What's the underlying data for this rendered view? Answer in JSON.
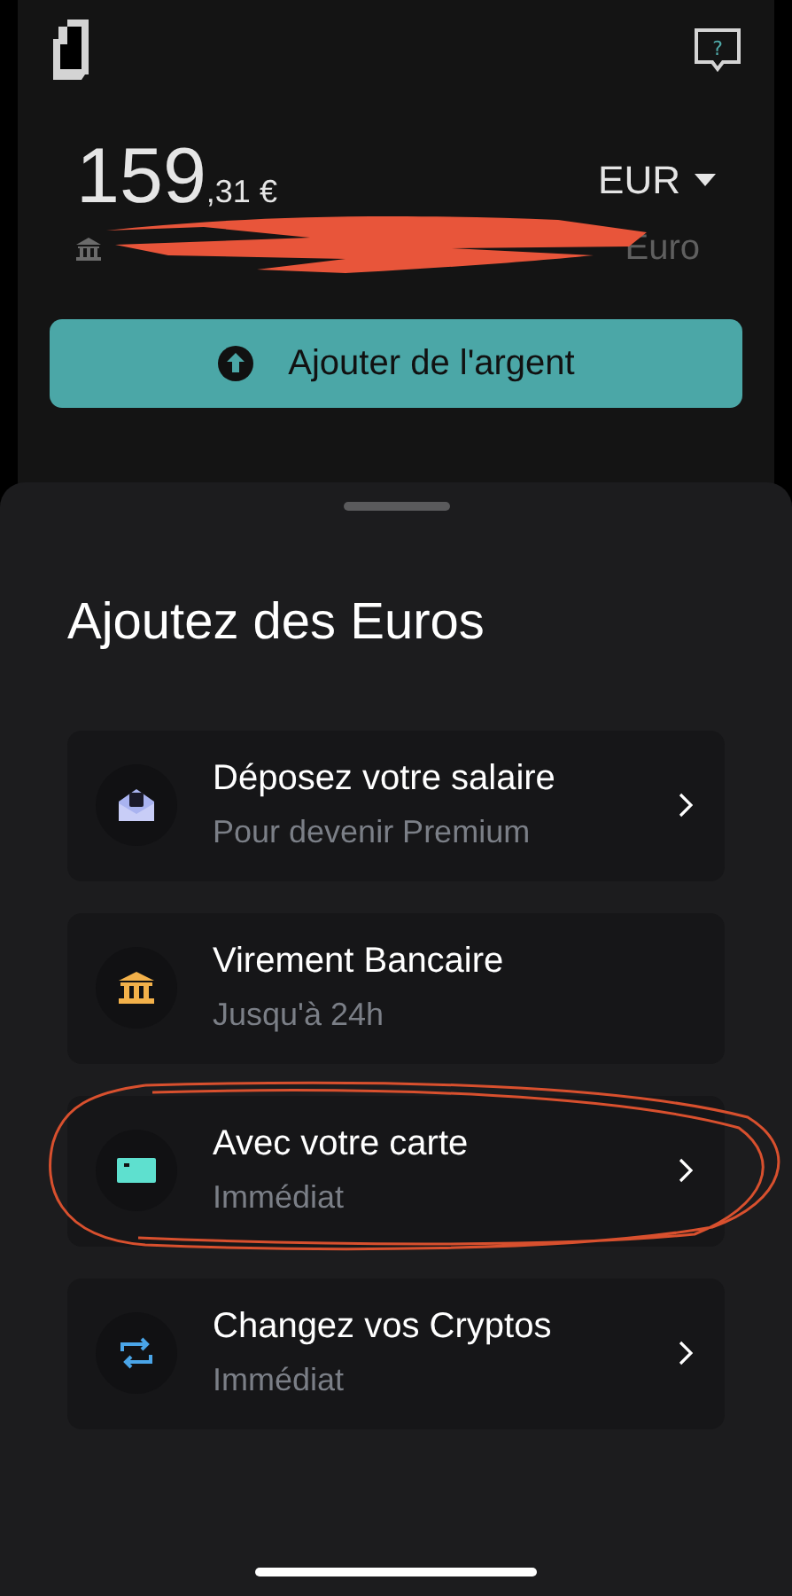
{
  "help_button": {
    "glyph": "?"
  },
  "balance": {
    "whole": "159",
    "fraction": ",31 €"
  },
  "currency": {
    "code": "EUR"
  },
  "account": {
    "visible_text": "Euro"
  },
  "add_button": {
    "label": "Ajouter de l'argent"
  },
  "sheet": {
    "title": "Ajoutez des Euros",
    "options": [
      {
        "kind": "salary",
        "title": "Déposez votre salaire",
        "subtitle": "Pour devenir Premium",
        "chevron": true
      },
      {
        "kind": "bank",
        "title": "Virement Bancaire",
        "subtitle": "Jusqu'à 24h",
        "chevron": false
      },
      {
        "kind": "card",
        "title": "Avec votre carte",
        "subtitle": "Immédiat",
        "chevron": true
      },
      {
        "kind": "crypto",
        "title": "Changez vos Cryptos",
        "subtitle": "Immédiat",
        "chevron": true
      }
    ]
  }
}
